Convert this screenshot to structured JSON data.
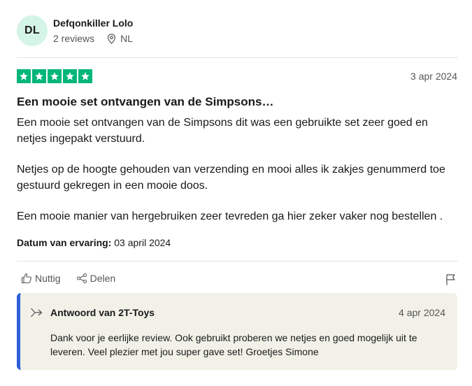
{
  "reviewer": {
    "initials": "DL",
    "name": "Defqonkiller Lolo",
    "reviews": "2 reviews",
    "country": "NL"
  },
  "review": {
    "rating": 5,
    "date": "3 apr 2024",
    "title": "Een mooie set ontvangen van de Simpsons…",
    "paragraphs": [
      "Een mooie set ontvangen van de Simpsons dit was een gebruikte set zeer goed en netjes ingepakt verstuurd.",
      "Netjes op de hoogte gehouden van verzending en mooi alles ik zakjes genummerd toe gestuurd gekregen in een mooie doos.",
      "Een mooie manier van hergebruiken zeer tevreden ga hier zeker vaker nog bestellen ."
    ],
    "experience_label": "Datum van ervaring:",
    "experience_date": "03 april 2024"
  },
  "actions": {
    "useful": "Nuttig",
    "share": "Delen"
  },
  "reply": {
    "title": "Antwoord van 2T-Toys",
    "date": "4 apr 2024",
    "body": "Dank voor je eerlijke review. Ook gebruikt proberen we netjes en goed mogelijk uit te leveren. Veel plezier met jou super gave set! Groetjes Simone"
  },
  "colors": {
    "star_green": "#00b67a",
    "avatar_bg": "#d4f4e5",
    "reply_accent": "#2c5fd9",
    "reply_bg": "#f1f1e8"
  }
}
